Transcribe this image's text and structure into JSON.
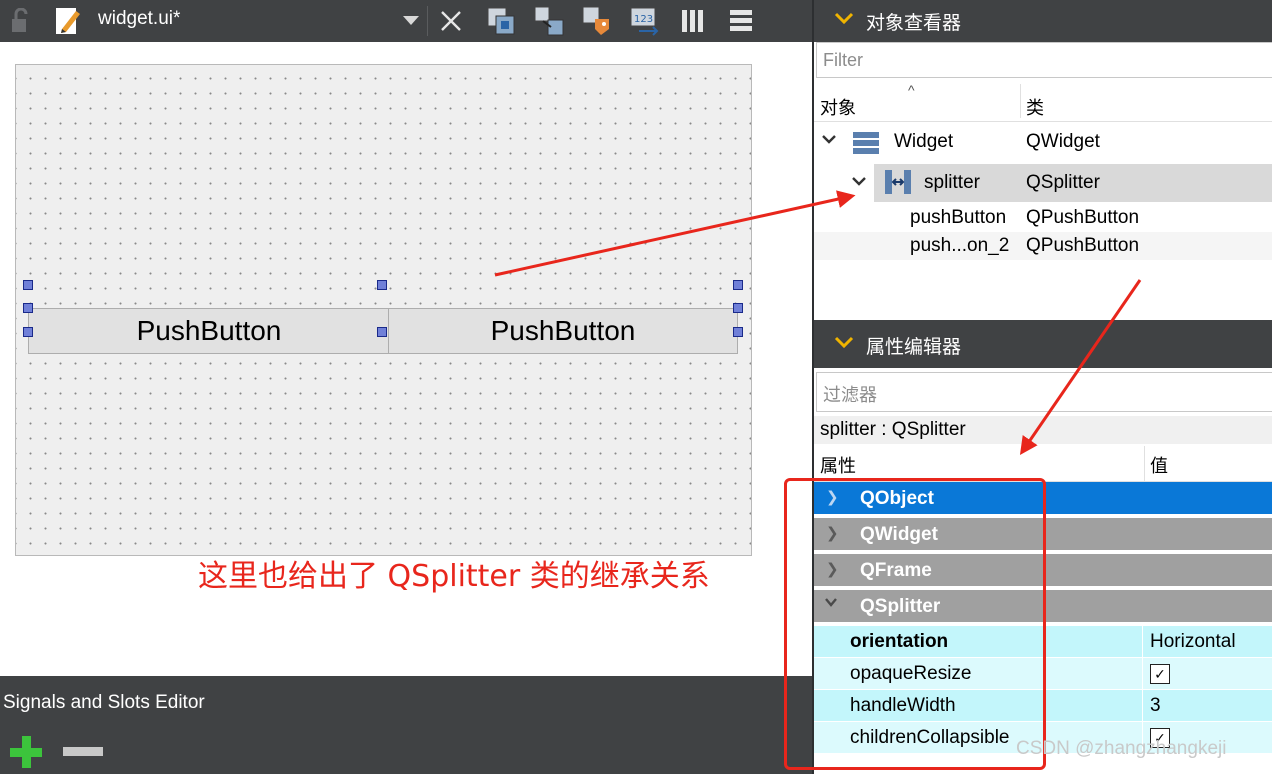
{
  "toolbar": {
    "file_name": "widget.ui*"
  },
  "form": {
    "button1_label": "PushButton",
    "button2_label": "PushButton"
  },
  "annotation": "这里也给出了 QSplitter 类的继承关系",
  "signals_panel": {
    "title": "Signals and Slots Editor"
  },
  "object_inspector": {
    "title": "对象查看器",
    "filter_placeholder": "Filter",
    "col_object": "对象",
    "col_class": "类",
    "rows": [
      {
        "name": "Widget",
        "class": "QWidget"
      },
      {
        "name": "splitter",
        "class": "QSplitter"
      },
      {
        "name": "pushButton",
        "class": "QPushButton"
      },
      {
        "name": "push...on_2",
        "class": "QPushButton"
      }
    ]
  },
  "property_editor": {
    "title": "属性编辑器",
    "filter_placeholder": "过滤器",
    "context": "splitter : QSplitter",
    "col_property": "属性",
    "col_value": "值",
    "groups": [
      "QObject",
      "QWidget",
      "QFrame",
      "QSplitter"
    ],
    "properties": [
      {
        "name": "orientation",
        "value": "Horizontal"
      },
      {
        "name": "opaqueResize",
        "value": "checked"
      },
      {
        "name": "handleWidth",
        "value": "3"
      },
      {
        "name": "childrenCollapsible",
        "value": "checked"
      }
    ]
  },
  "watermark": "CSDN @zhangzhangkeji",
  "colors": {
    "dark_panel": "#404244",
    "selected_group": "#0a78d7",
    "group_bg": "#a0a0a0",
    "property_bg": "#c3f6fb",
    "annotation": "#e8261c"
  }
}
